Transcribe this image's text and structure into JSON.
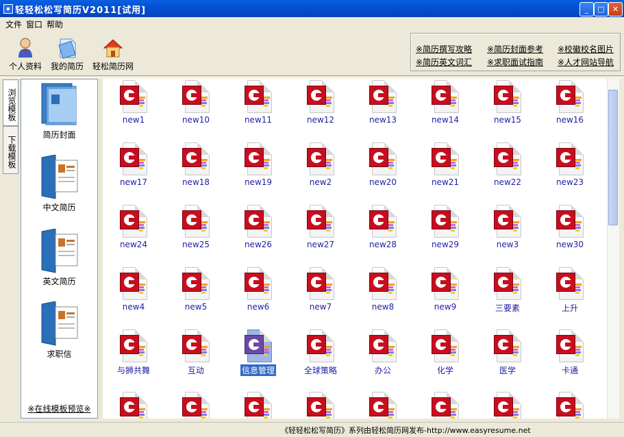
{
  "window": {
    "title": "轻轻松松写简历V2011[试用]",
    "min": "_",
    "max": "□",
    "close": "✕"
  },
  "menu": [
    "文件",
    "窗口",
    "帮助"
  ],
  "toolbar": {
    "profile": "个人资料",
    "my_resume": "我的简历",
    "site": "轻松简历网"
  },
  "links": [
    "※简历撰写攻略",
    "※简历封面参考",
    "※校徽校名图片",
    "※简历英文词汇",
    "※求职面试指南",
    "※人才网站导航"
  ],
  "tabs": [
    "浏览模板",
    "下载模板"
  ],
  "categories": [
    "简历封面",
    "中文简历",
    "英文简历",
    "求职信"
  ],
  "online_preview": "※在线模板预览※",
  "templates": [
    "new1",
    "new10",
    "new11",
    "new12",
    "new13",
    "new14",
    "new15",
    "new16",
    "new17",
    "new18",
    "new19",
    "new2",
    "new20",
    "new21",
    "new22",
    "new23",
    "new24",
    "new25",
    "new26",
    "new27",
    "new28",
    "new29",
    "new3",
    "new30",
    "new4",
    "new5",
    "new6",
    "new7",
    "new8",
    "new9",
    "三要素",
    "上升",
    "与狮共舞",
    "互动",
    "信息管理",
    "全球策略",
    "办公",
    "化学",
    "医学",
    "卡通"
  ],
  "selected_template": "信息管理",
  "status": "《轻轻松松写简历》系列由轻松简历网发布-http://www.easyresume.net",
  "colors": {
    "titlebar": "#0a52d8",
    "badge": "#c80e1e",
    "selection": "#316ac5"
  }
}
